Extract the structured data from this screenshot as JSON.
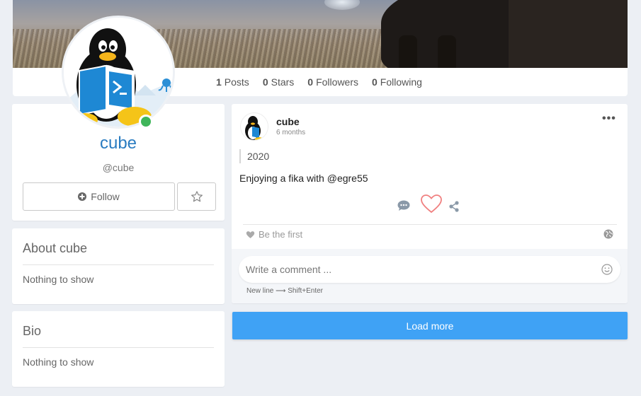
{
  "stats": [
    {
      "count": "1",
      "label": "Posts"
    },
    {
      "count": "0",
      "label": "Stars"
    },
    {
      "count": "0",
      "label": "Followers"
    },
    {
      "count": "0",
      "label": "Following"
    }
  ],
  "profile": {
    "name": "cube",
    "handle": "@cube",
    "follow_label": "Follow",
    "online": true
  },
  "about": {
    "title": "About cube",
    "empty": "Nothing to show"
  },
  "bio": {
    "title": "Bio",
    "empty": "Nothing to show"
  },
  "post": {
    "author": "cube",
    "time": "6 months",
    "quote": "2020",
    "body": "Enjoying a fika with @egre55",
    "likes_text": "Be the first"
  },
  "comment": {
    "placeholder": "Write a comment ...",
    "hint": "New line ⟶ Shift+Enter"
  },
  "load_more_label": "Load more",
  "colors": {
    "accent": "#3fa2f5",
    "name": "#2a7cc1",
    "online": "#3fb55a",
    "heart": "#f08080"
  }
}
